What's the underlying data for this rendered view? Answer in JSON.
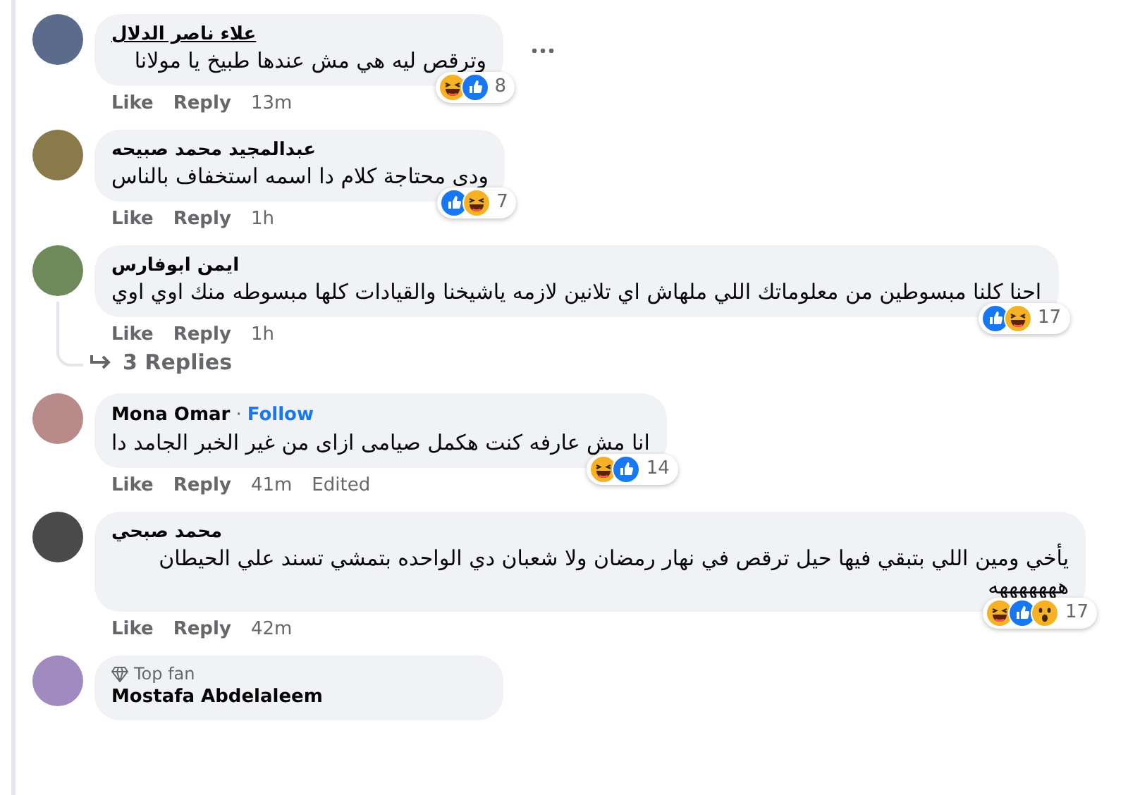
{
  "comments": [
    {
      "author": "علاء ناصر الدلال",
      "author_underlined": true,
      "text": "وترقص ليه هي مش عندها طبيخ يا مولانا",
      "reactions": [
        {
          "kind": "haha"
        },
        {
          "kind": "like"
        }
      ],
      "reaction_count": "8",
      "like": "Like",
      "reply": "Reply",
      "time": "13m",
      "more_options": true
    },
    {
      "author": "عبدالمجيد محمد صبيحه",
      "author_underlined": false,
      "text": "ودى محتاجة كلام دا اسمه استخفاف بالناس",
      "reactions": [
        {
          "kind": "like"
        },
        {
          "kind": "haha"
        }
      ],
      "reaction_count": "7",
      "like": "Like",
      "reply": "Reply",
      "time": "1h",
      "more_options": false
    },
    {
      "author": "ايمن ابوفارس",
      "author_underlined": false,
      "text": "احنا كلنا مبسوطين من معلوماتك اللي ملهاش اي تلانين لازمه ياشيخنا والقيادات كلها مبسوطه منك اوي اوي",
      "reactions": [
        {
          "kind": "like"
        },
        {
          "kind": "haha"
        }
      ],
      "reaction_count": "17",
      "like": "Like",
      "reply": "Reply",
      "time": "1h",
      "more_options": false,
      "replies": "3 Replies"
    },
    {
      "author": "Mona Omar",
      "author_underlined": false,
      "separator": "·",
      "follow": "Follow",
      "text": "انا مش عارفه كنت هكمل صيامى ازاى من غير الخبر الجامد دا",
      "reactions": [
        {
          "kind": "haha"
        },
        {
          "kind": "like"
        }
      ],
      "reaction_count": "14",
      "like": "Like",
      "reply": "Reply",
      "time": "41m",
      "edited": "Edited",
      "more_options": false
    },
    {
      "author": "محمد صبحي",
      "author_underlined": false,
      "text": "يأخي ومين اللي بتبقي فيها حيل ترقص في نهار رمضان ولا شعبان دي الواحده بتمشي تسند علي الحيطان هههههههه",
      "reactions": [
        {
          "kind": "haha"
        },
        {
          "kind": "like"
        },
        {
          "kind": "wow"
        }
      ],
      "reaction_count": "17",
      "like": "Like",
      "reply": "Reply",
      "time": "42m",
      "more_options": false
    },
    {
      "badge": "Top fan",
      "author": "Mostafa Abdelaleem",
      "author_underlined": false,
      "more_options": false
    }
  ]
}
